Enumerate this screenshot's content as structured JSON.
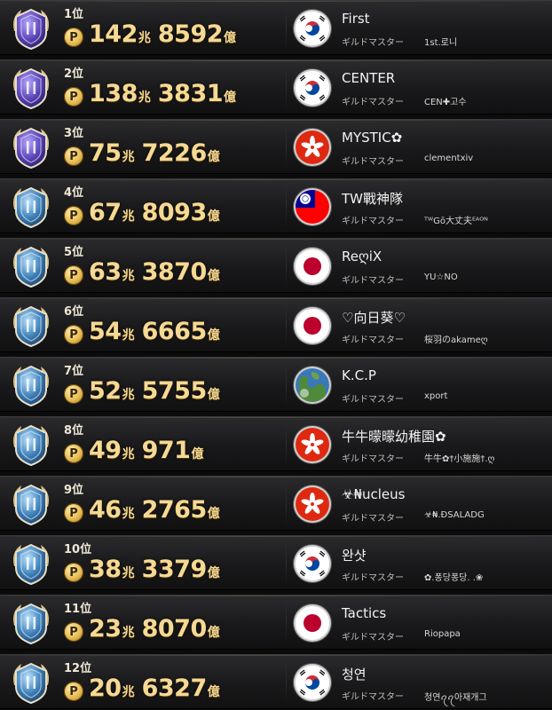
{
  "colors": {
    "gold_text": "#f5d994",
    "emblem_purple": "#7a6ad0",
    "emblem_blue": "#5aa7d8",
    "background": "#0b0b0c"
  },
  "guild_master_label": "ギルドマスター",
  "trillion_unit": "兆",
  "hundred_million_unit": "億",
  "coin_icon": "P",
  "rows": [
    {
      "rank": "1位",
      "trillion": "142",
      "oku": "8592",
      "guild": "First",
      "master": "1st.로니",
      "flag": "south-korea-flag-icon",
      "tier": "purple"
    },
    {
      "rank": "2位",
      "trillion": "138",
      "oku": "3831",
      "guild": "CENTER",
      "master": "CEN✚고수",
      "flag": "south-korea-flag-icon",
      "tier": "purple"
    },
    {
      "rank": "3位",
      "trillion": "75",
      "oku": "7226",
      "guild": "MYSTIC✿",
      "master": "clementxiv",
      "flag": "hong-kong-flag-icon",
      "tier": "purple"
    },
    {
      "rank": "4位",
      "trillion": "67",
      "oku": "8093",
      "guild": "TW戰神隊",
      "master": "ᵀᵂGō大丈夫ᴱᴬᴼᴺ",
      "flag": "taiwan-flag-icon",
      "tier": "blue"
    },
    {
      "rank": "5位",
      "trillion": "63",
      "oku": "3870",
      "guild": "ReღiX",
      "master": "YU☆NO",
      "flag": "japan-flag-icon",
      "tier": "blue"
    },
    {
      "rank": "6位",
      "trillion": "54",
      "oku": "6665",
      "guild": "♡向日葵♡",
      "master": "桜羽のakameღ",
      "flag": "japan-flag-icon",
      "tier": "blue"
    },
    {
      "rank": "7位",
      "trillion": "52",
      "oku": "5755",
      "guild": "K.C.P",
      "master": "xport",
      "flag": "globe-icon",
      "tier": "blue"
    },
    {
      "rank": "8位",
      "trillion": "49",
      "oku": "971",
      "guild": "牛牛曚曚幼稚園✿",
      "master": "牛牛✿†小施施†.ღ",
      "flag": "hong-kong-flag-icon",
      "tier": "blue"
    },
    {
      "rank": "9位",
      "trillion": "46",
      "oku": "2765",
      "guild": "☣₦ucleus",
      "master": "☣₦.ĐSALADG",
      "flag": "hong-kong-flag-icon",
      "tier": "blue"
    },
    {
      "rank": "10位",
      "trillion": "38",
      "oku": "3379",
      "guild": "완샷",
      "master": "✿.퐁당퐁당. .❀",
      "flag": "south-korea-flag-icon",
      "tier": "blue"
    },
    {
      "rank": "11位",
      "trillion": "23",
      "oku": "8070",
      "guild": "Tactics",
      "master": "Riopapa",
      "flag": "japan-flag-icon",
      "tier": "blue"
    },
    {
      "rank": "12位",
      "trillion": "20",
      "oku": "6327",
      "guild": "청연",
      "master": "청연ꪖꪖ아재개그",
      "flag": "south-korea-flag-icon",
      "tier": "blue"
    }
  ]
}
